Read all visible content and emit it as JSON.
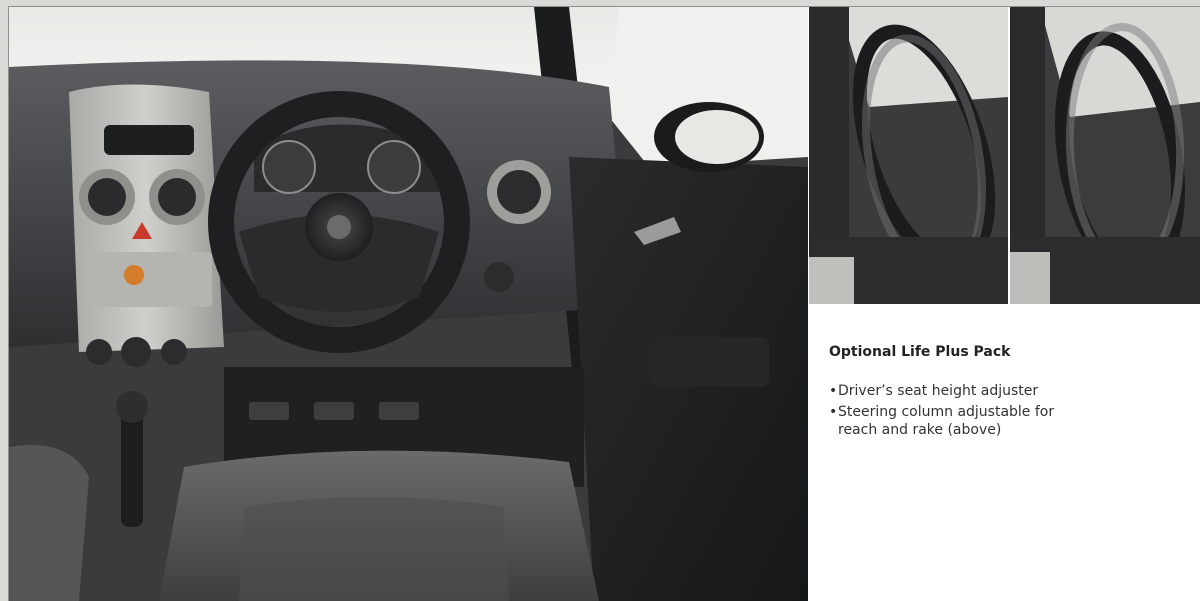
{
  "colors": {
    "frame": "#d9d9d6",
    "text": "#333333",
    "dashboard": "#3a3b3d",
    "trim": "#b9b9b5"
  },
  "images": {
    "main": "car-interior-dashboard-photo",
    "thumb_1": "steering-column-adjust-photo-1",
    "thumb_2": "steering-column-adjust-photo-2"
  },
  "caption": {
    "title": "Optional Life Plus Pack",
    "bullet_glyph": "•",
    "items": [
      {
        "line1": "Driver’s seat height adjuster",
        "line2": ""
      },
      {
        "line1": "Steering column adjustable for",
        "line2": "reach and rake (above)"
      }
    ]
  }
}
